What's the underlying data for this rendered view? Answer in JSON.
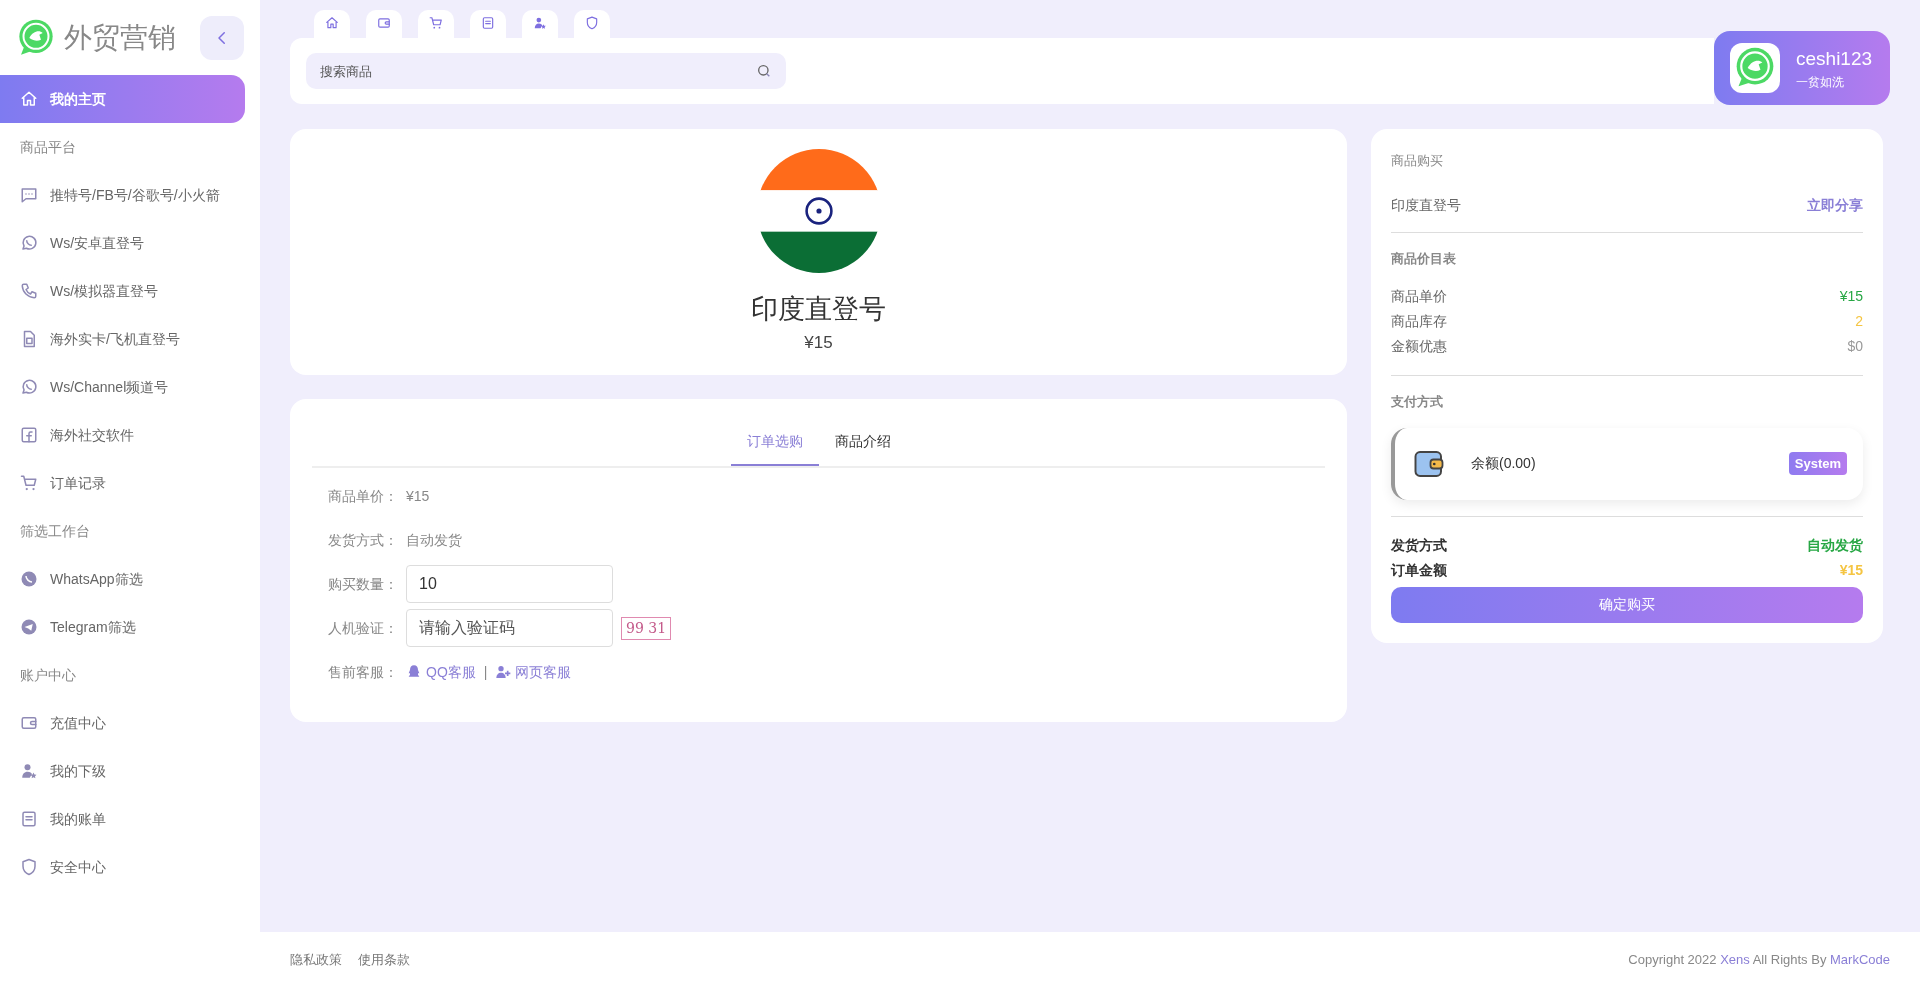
{
  "sidebar": {
    "brand": "外贸营销",
    "items": [
      {
        "kind": "link",
        "label": "我的主页",
        "selected": true
      },
      {
        "kind": "header",
        "label": "商品平台"
      },
      {
        "kind": "link",
        "label": "推特号/FB号/谷歌号/小火箭",
        "selected": false
      },
      {
        "kind": "link",
        "label": "Ws/安卓直登号",
        "selected": false
      },
      {
        "kind": "link",
        "label": "Ws/模拟器直登号",
        "selected": false
      },
      {
        "kind": "link",
        "label": "海外实卡/飞机直登号",
        "selected": false
      },
      {
        "kind": "link",
        "label": "Ws/Channel频道号",
        "selected": false
      },
      {
        "kind": "link",
        "label": "海外社交软件",
        "selected": false
      },
      {
        "kind": "link",
        "label": "订单记录",
        "selected": false
      },
      {
        "kind": "header",
        "label": "筛选工作台"
      },
      {
        "kind": "link",
        "label": "WhatsApp筛选",
        "selected": false
      },
      {
        "kind": "link",
        "label": "Telegram筛选",
        "selected": false
      },
      {
        "kind": "header",
        "label": "账户中心"
      },
      {
        "kind": "link",
        "label": "充值中心",
        "selected": false
      },
      {
        "kind": "link",
        "label": "我的下级",
        "selected": false
      },
      {
        "kind": "link",
        "label": "我的账单",
        "selected": false
      },
      {
        "kind": "link",
        "label": "安全中心",
        "selected": false
      }
    ]
  },
  "topbar": {
    "search": {
      "placeholder": "搜索商品"
    }
  },
  "user": {
    "name": "ceshi123",
    "tagline": "一贫如洗"
  },
  "product": {
    "title": "印度直登号",
    "price": "¥15"
  },
  "order": {
    "tabs": [
      {
        "label": "订单选购",
        "selected": true
      },
      {
        "label": "商品介绍",
        "selected": false
      }
    ],
    "fields": [
      {
        "kind": "text",
        "label": "商品单价：",
        "value": "¥15"
      },
      {
        "kind": "text",
        "label": "发货方式：",
        "value": "自动发货"
      },
      {
        "kind": "input",
        "label": "购买数量：",
        "value": "10"
      },
      {
        "kind": "captcha",
        "label": "人机验证：",
        "placeholder": "请输入验证码",
        "code": "99 31"
      },
      {
        "kind": "links",
        "label": "售前客服：",
        "links": [
          "QQ客服",
          "网页客服"
        ],
        "separator": "|"
      }
    ]
  },
  "purchase": {
    "title": "商品购买",
    "product": "印度直登号",
    "share": "立即分享",
    "price_title": "商品价目表",
    "prices": [
      {
        "label": "商品单价",
        "value": "¥15",
        "color": "#28a745"
      },
      {
        "label": "商品库存",
        "value": "2",
        "color": "#f5c542"
      },
      {
        "label": "金额优惠",
        "value": "$0",
        "color": "#999999"
      }
    ],
    "payment_title": "支付方式",
    "payment": {
      "label": "余额(0.00)",
      "badge": "System",
      "selected": true
    },
    "summary": [
      {
        "label": "发货方式",
        "value": "自动发货",
        "color": "#28a745"
      },
      {
        "label": "订单金额",
        "value": "¥15",
        "color": "#f5c542"
      }
    ],
    "button": "确定购买"
  },
  "footer": {
    "links": [
      "隐私政策",
      "使用条款"
    ],
    "copyright": [
      {
        "kind": "text",
        "text": "Copyright 2022"
      },
      {
        "kind": "link",
        "text": "Xens"
      },
      {
        "kind": "text",
        "text": "All Rights By"
      },
      {
        "kind": "link",
        "text": "MarkCode"
      }
    ]
  }
}
